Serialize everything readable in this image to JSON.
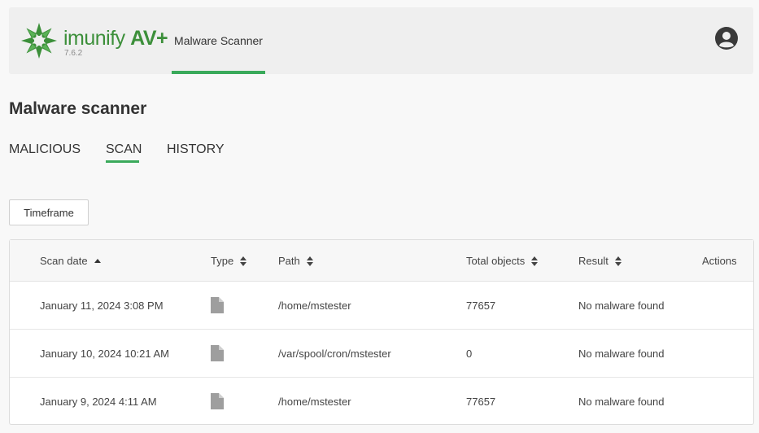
{
  "header": {
    "brand_name": "imunify",
    "brand_suffix": "AV+",
    "version": "7.6.2",
    "nav_tab": "Malware Scanner",
    "accent_color": "#3aaa5b",
    "brand_color": "#3c8f3a"
  },
  "page": {
    "title": "Malware scanner"
  },
  "tabs": [
    {
      "label": "MALICIOUS",
      "active": false
    },
    {
      "label": "SCAN",
      "active": true
    },
    {
      "label": "HISTORY",
      "active": false
    }
  ],
  "timeframe_label": "Timeframe",
  "table": {
    "columns": {
      "scan_date": "Scan date",
      "type": "Type",
      "path": "Path",
      "total_objects": "Total objects",
      "result": "Result",
      "actions": "Actions"
    },
    "rows": [
      {
        "scan_date": "January 11, 2024 3:08 PM",
        "type_icon": "file-icon",
        "path": "/home/mstester",
        "total_objects": "77657",
        "result": "No malware found"
      },
      {
        "scan_date": "January 10, 2024 10:21 AM",
        "type_icon": "file-icon",
        "path": "/var/spool/cron/mstester",
        "total_objects": "0",
        "result": "No malware found"
      },
      {
        "scan_date": "January 9, 2024 4:11 AM",
        "type_icon": "file-icon",
        "path": "/home/mstester",
        "total_objects": "77657",
        "result": "No malware found"
      }
    ]
  }
}
